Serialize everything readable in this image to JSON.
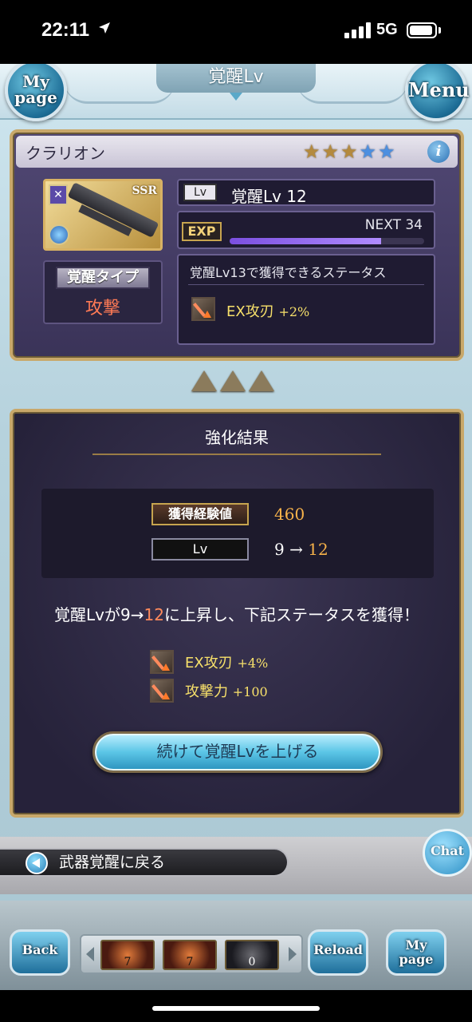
{
  "status_bar": {
    "time": "22:11",
    "network": "5G"
  },
  "header": {
    "title": "覚醒Lv",
    "mypage_label": "My page",
    "menu_label": "Menu"
  },
  "weapon": {
    "name": "クラリオン",
    "stars_filled": 3,
    "stars_total": 5,
    "rarity": "SSR",
    "awakening_type_label": "覚醒タイプ",
    "awakening_type_value": "攻撃",
    "lv_tag": "Lv",
    "lv_text": "覚醒Lv 12",
    "exp_tag": "EXP",
    "next_text": "NEXT 34",
    "exp_progress": 0.78,
    "next_level_title": "覚醒Lv13で獲得できるステータス",
    "next_level_skill": {
      "name": "EX攻刃",
      "value": "+2%"
    }
  },
  "result": {
    "title": "強化結果",
    "exp_label": "獲得経験値",
    "exp_value": "460",
    "lv_label": "Lv",
    "lv_from": "9",
    "lv_arrow": "→",
    "lv_to": "12",
    "message_pre": "覚醒Lvが9→",
    "message_hl": "12",
    "message_post": "に上昇し、下記ステータスを獲得！",
    "skills": [
      {
        "name": "EX攻刃",
        "value": "+4%"
      },
      {
        "name": "攻撃力",
        "value": "+100"
      }
    ],
    "continue_label": "続けて覚醒Lvを上げる"
  },
  "back_link": {
    "label": "武器覚醒に戻る",
    "chat_label": "Chat"
  },
  "footer": {
    "back_label": "Back",
    "reload_label": "Reload",
    "mypage_label": "My page",
    "items": [
      {
        "count": "7"
      },
      {
        "count": "7"
      },
      {
        "count": "0"
      }
    ]
  },
  "colors": {
    "accent_gold": "#c8a86a",
    "highlight_orange": "#ff8a5c",
    "skill_yellow": "#f7e06a",
    "exp_purple": "#7b4fe0"
  }
}
